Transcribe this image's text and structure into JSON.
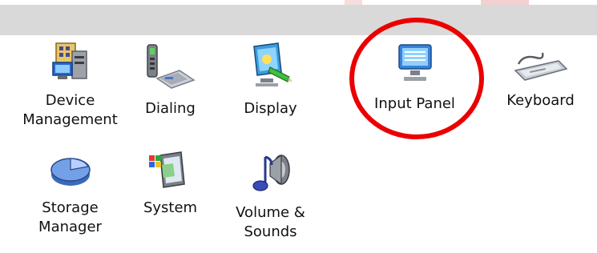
{
  "items": [
    {
      "label": "Device\nManagement",
      "icon": "device-management-icon"
    },
    {
      "label": "Dialing",
      "icon": "dialing-phone-icon"
    },
    {
      "label": "Display",
      "icon": "display-monitor-icon"
    },
    {
      "label": "Input Panel",
      "icon": "input-panel-monitor-icon"
    },
    {
      "label": "Keyboard",
      "icon": "keyboard-icon"
    },
    {
      "label": "Storage\nManager",
      "icon": "storage-pie-icon"
    },
    {
      "label": "System",
      "icon": "system-windows-icon"
    },
    {
      "label": "Volume &\nSounds",
      "icon": "volume-music-icon"
    }
  ],
  "annotation": {
    "color": "#ea0000"
  }
}
